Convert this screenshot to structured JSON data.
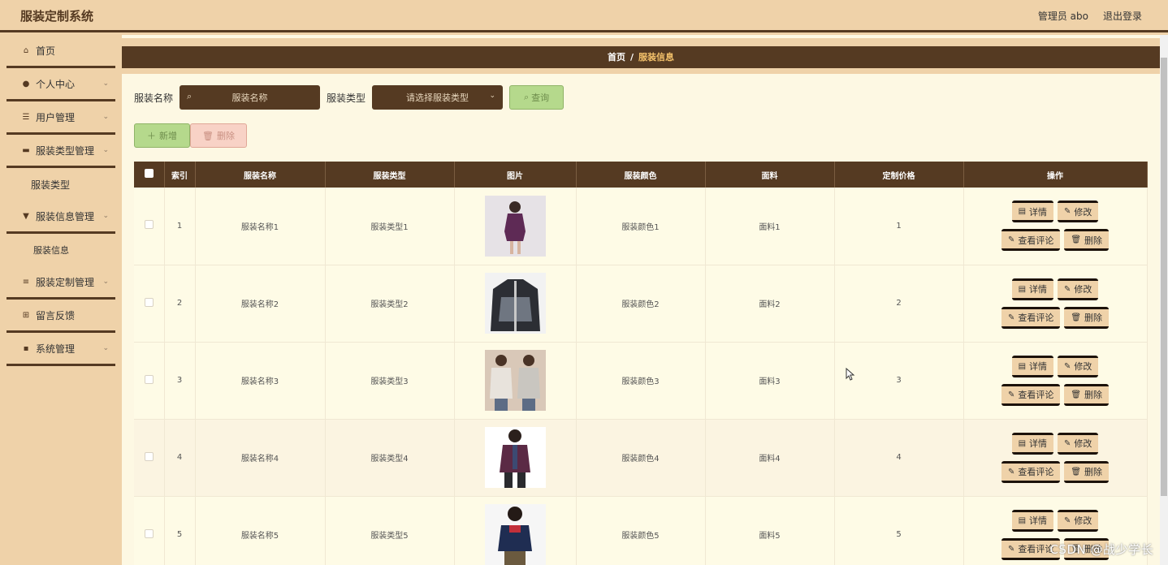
{
  "header": {
    "brand": "服装定制系统",
    "user_label": "管理员 abo",
    "logout_label": "退出登录"
  },
  "sidebar": {
    "items": [
      {
        "label": "首页",
        "icon": "home-icon"
      },
      {
        "label": "个人中心",
        "icon": "user-icon"
      },
      {
        "label": "用户管理",
        "icon": "sliders-icon"
      },
      {
        "label": "服装类型管理",
        "icon": "briefcase-icon"
      },
      {
        "label": "服装类型",
        "sub": true
      },
      {
        "label": "服装信息管理",
        "icon": "shirt-icon"
      },
      {
        "label": "服装信息",
        "sub": true
      },
      {
        "label": "服装定制管理",
        "icon": "list-icon"
      },
      {
        "label": "留言反馈",
        "icon": "grid-icon"
      },
      {
        "label": "系统管理",
        "icon": "apps-icon"
      }
    ]
  },
  "breadcrumb": {
    "home": "首页",
    "separator": "/",
    "current": "服装信息"
  },
  "search": {
    "name_label": "服装名称",
    "name_placeholder": "服装名称",
    "type_label": "服装类型",
    "type_placeholder": "请选择服装类型",
    "query_label": "查询"
  },
  "actions": {
    "add_label": "新增",
    "delete_label": "删除"
  },
  "table": {
    "headers": [
      "索引",
      "服装名称",
      "服装类型",
      "图片",
      "服装颜色",
      "面料",
      "定制价格",
      "操作"
    ],
    "rows": [
      {
        "index": "1",
        "name": "服装名称1",
        "type": "服装类型1",
        "color": "服装颜色1",
        "fabric": "面料1",
        "price": "1"
      },
      {
        "index": "2",
        "name": "服装名称2",
        "type": "服装类型2",
        "color": "服装颜色2",
        "fabric": "面料2",
        "price": "2"
      },
      {
        "index": "3",
        "name": "服装名称3",
        "type": "服装类型3",
        "color": "服装颜色3",
        "fabric": "面料3",
        "price": "3"
      },
      {
        "index": "4",
        "name": "服装名称4",
        "type": "服装类型4",
        "color": "服装颜色4",
        "fabric": "面料4",
        "price": "4"
      },
      {
        "index": "5",
        "name": "服装名称5",
        "type": "服装类型5",
        "color": "服装颜色5",
        "fabric": "面料5",
        "price": "5"
      }
    ],
    "row_actions": {
      "detail": "详情",
      "edit": "修改",
      "comments": "查看评论",
      "delete": "删除"
    }
  },
  "watermark": "CSDN @战少学长",
  "colors": {
    "primary": "#553a22",
    "background": "#efd2a9",
    "content": "#fdf8e3",
    "accent": "#f4c26b",
    "success": "#b5d98c",
    "danger": "#f8d2c6"
  }
}
